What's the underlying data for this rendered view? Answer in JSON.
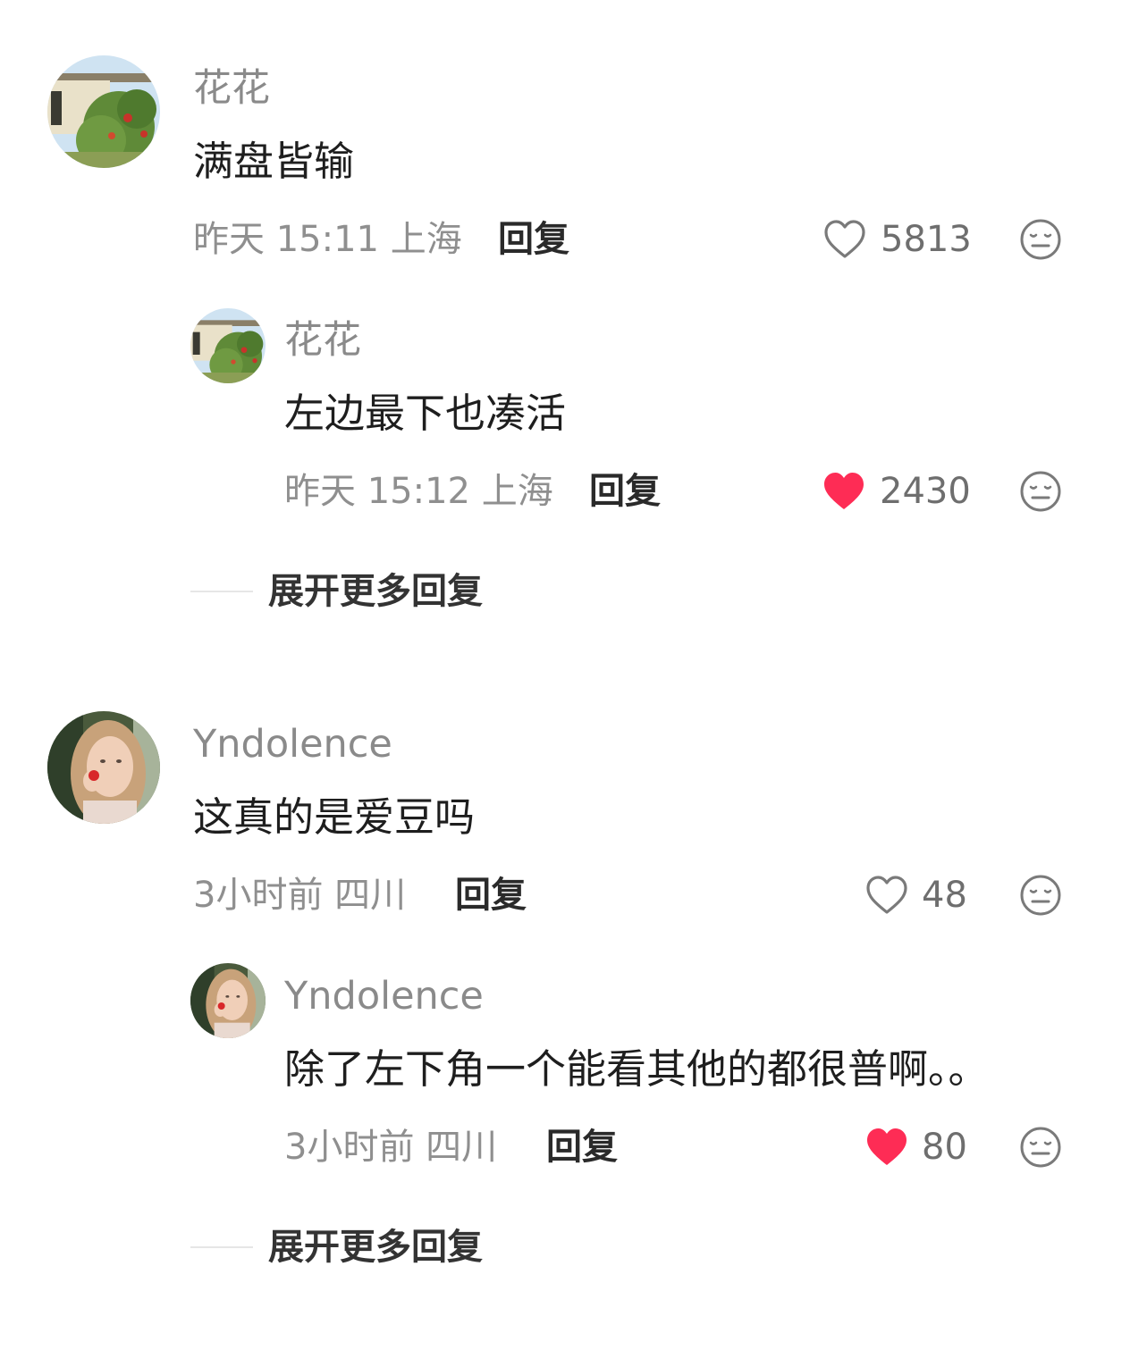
{
  "comments": [
    {
      "user": "花花",
      "text": "满盘皆输",
      "time": "昨天 15:11",
      "location": "上海",
      "reply_label": "回复",
      "likes": "5813",
      "liked": false,
      "avatar": "garden-photo",
      "replies": [
        {
          "user": "花花",
          "text": "左边最下也凑活",
          "time": "昨天 15:12",
          "location": "上海",
          "reply_label": "回复",
          "likes": "2430",
          "liked": true,
          "avatar": "garden-photo"
        }
      ],
      "expand_label": "展开更多回复"
    },
    {
      "user": "Yndolence",
      "text": "这真的是爱豆吗",
      "time": "3小时前",
      "location": "四川",
      "reply_label": "回复",
      "likes": "48",
      "liked": false,
      "avatar": "girl-portrait",
      "replies": [
        {
          "user": "Yndolence",
          "text": "除了左下角一个能看其他的都很普啊。。",
          "time": "3小时前",
          "location": "四川",
          "reply_label": "回复",
          "likes": "80",
          "liked": true,
          "avatar": "girl-portrait"
        }
      ],
      "expand_label": "展开更多回复"
    }
  ],
  "icons": {
    "like": "heart-icon",
    "dislike": "meh-face-icon"
  },
  "colors": {
    "liked": "#fe2c55",
    "muted": "#8f8f8f",
    "text": "#1e1e1e"
  }
}
